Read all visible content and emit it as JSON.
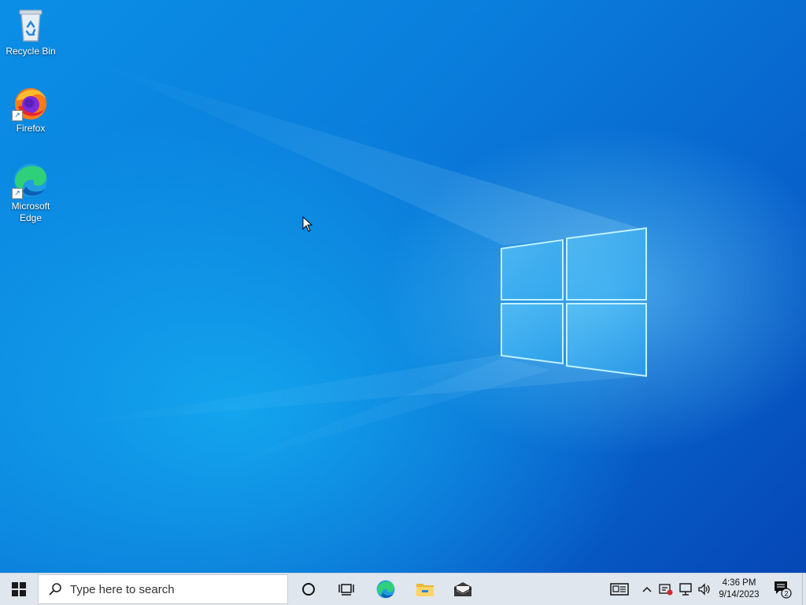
{
  "desktop": {
    "icons": [
      {
        "label": "Recycle Bin",
        "icon": "recycle-bin-icon"
      },
      {
        "label": "Firefox",
        "icon": "firefox-icon"
      },
      {
        "label": "Microsoft Edge",
        "icon": "edge-icon"
      }
    ]
  },
  "taskbar": {
    "start_icon": "windows-logo-icon",
    "search": {
      "placeholder": "Type here to search",
      "icon": "search-icon"
    },
    "pinned": [
      {
        "name": "cortana",
        "icon": "cortana-circle-icon"
      },
      {
        "name": "task-view",
        "icon": "task-view-icon"
      },
      {
        "name": "edge",
        "icon": "edge-icon"
      },
      {
        "name": "file-explorer",
        "icon": "folder-icon"
      },
      {
        "name": "mail",
        "icon": "mail-icon"
      }
    ],
    "tray": {
      "news_icon": "news-interests-icon",
      "chevron_icon": "chevron-up-icon",
      "icons": [
        "security-alert-icon",
        "network-icon",
        "volume-icon"
      ],
      "time": "4:36 PM",
      "date": "9/14/2023",
      "notifications_count": "2"
    }
  }
}
